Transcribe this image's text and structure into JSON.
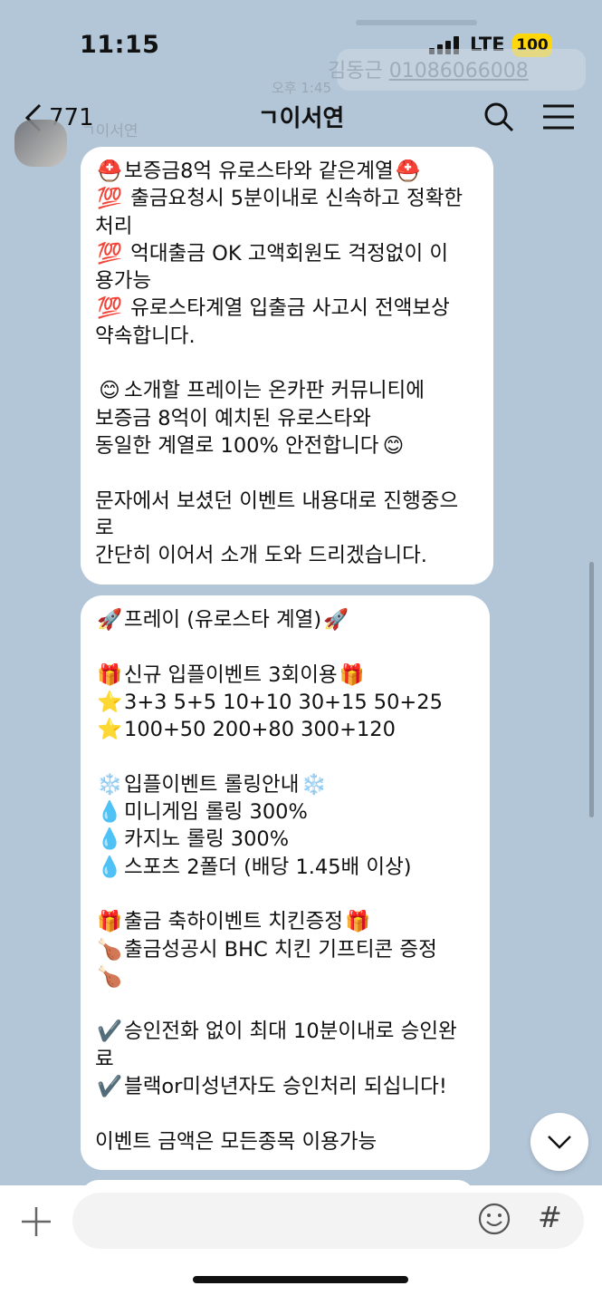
{
  "status": {
    "time": "11:15",
    "network": "LTE",
    "battery": "100"
  },
  "ghost": {
    "name": "김동근",
    "phone": "01086066008",
    "time": "오후 1:45"
  },
  "header": {
    "back_count": "771",
    "title": "ㄱ이서연"
  },
  "sender": "ㄱ이서연",
  "message1": {
    "lines": [
      {
        "e1": "⛑️",
        "t": "보증금8억 유로스타와 같은계열",
        "e2": "⛑️"
      },
      {
        "e1": "💯",
        "t": " 출금요청시 5분이내로 신속하고 정확한",
        "e2": ""
      },
      {
        "e1": "",
        "t": "처리",
        "e2": ""
      },
      {
        "e1": "💯",
        "t": " 억대출금 OK 고액회원도 걱정없이 이",
        "e2": ""
      },
      {
        "e1": "",
        "t": "용가능",
        "e2": ""
      },
      {
        "e1": "💯",
        "t": " 유로스타계열 입출금 사고시 전액보상",
        "e2": ""
      },
      {
        "e1": "",
        "t": "약속합니다.",
        "e2": ""
      },
      {
        "e1": "",
        "t": "",
        "e2": ""
      },
      {
        "e1": "😊",
        "t": "소개할 프레이는 온카판 커뮤니티에",
        "e2": ""
      },
      {
        "e1": "",
        "t": "보증금 8억이 예치된 유로스타와",
        "e2": ""
      },
      {
        "e1": "",
        "t": "동일한 계열로 100% 안전합니다",
        "e2": "😊"
      },
      {
        "e1": "",
        "t": "",
        "e2": ""
      },
      {
        "e1": "",
        "t": "문자에서 보셨던 이벤트 내용대로 진행중으",
        "e2": ""
      },
      {
        "e1": "",
        "t": "로",
        "e2": ""
      },
      {
        "e1": "",
        "t": "간단히 이어서 소개 도와 드리겠습니다.",
        "e2": ""
      }
    ]
  },
  "message2": {
    "lines": [
      {
        "e1": "🚀",
        "t": "프레이 (유로스타 계열)",
        "e2": "🚀"
      },
      {
        "e1": "",
        "t": "",
        "e2": ""
      },
      {
        "e1": "🎁",
        "t": "신규 입플이벤트 3회이용",
        "e2": "🎁"
      },
      {
        "e1": "⭐",
        "t": "3+3 5+5 10+10 30+15 50+25",
        "e2": ""
      },
      {
        "e1": "⭐",
        "t": "100+50 200+80 300+120",
        "e2": ""
      },
      {
        "e1": "",
        "t": "",
        "e2": ""
      },
      {
        "e1": "❄️",
        "t": "입플이벤트 롤링안내",
        "e2": "❄️"
      },
      {
        "e1": "💧",
        "t": "미니게임 롤링 300%",
        "e2": ""
      },
      {
        "e1": "💧",
        "t": "카지노 롤링 300%",
        "e2": ""
      },
      {
        "e1": "💧",
        "t": "스포츠 2폴더 (배당 1.45배 이상)",
        "e2": ""
      },
      {
        "e1": "",
        "t": "",
        "e2": ""
      },
      {
        "e1": "🎁",
        "t": "출금 축하이벤트 치킨증정",
        "e2": "🎁"
      },
      {
        "e1": "🍗",
        "t": "출금성공시 BHC 치킨 기프티콘 증정",
        "e2": ""
      },
      {
        "e1": "🍗",
        "t": "",
        "e2": ""
      },
      {
        "e1": "",
        "t": "",
        "e2": ""
      },
      {
        "e1": "✔️",
        "t": "승인전화 없이 최대 10분이내로 승인완",
        "e2": ""
      },
      {
        "e1": "",
        "t": "료",
        "e2": ""
      },
      {
        "e1": "✔️",
        "t": "블랙or미성년자도 승인처리 되십니다!",
        "e2": ""
      },
      {
        "e1": "",
        "t": "",
        "e2": ""
      },
      {
        "e1": "",
        "t": "이벤트 금액은 모든종목 이용가능",
        "e2": ""
      }
    ]
  },
  "input": {
    "placeholder": "",
    "hash": "#"
  },
  "colors": {
    "background": "#b3c6d8",
    "bubble": "#ffffff",
    "battery": "#ffd60a"
  },
  "icons": [
    "back-chevron-icon",
    "search-icon",
    "menu-icon",
    "chevron-down-icon",
    "plus-icon",
    "emoji-icon",
    "hash-icon"
  ]
}
